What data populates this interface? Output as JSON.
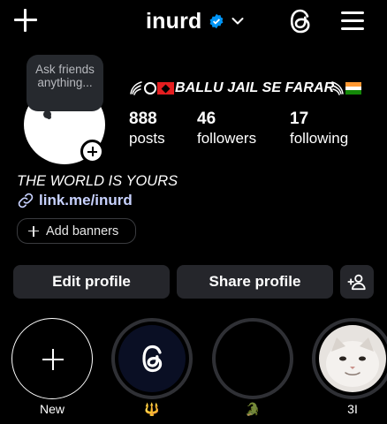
{
  "header": {
    "username": "inurd"
  },
  "note": {
    "text": "Ask friends anything..."
  },
  "profile": {
    "display_name": "BALLU JAIL SE FARAR",
    "stats": [
      {
        "value": "888",
        "label": "posts"
      },
      {
        "value": "46",
        "label": "followers"
      },
      {
        "value": "17",
        "label": "following"
      }
    ],
    "bio": "THE WORLD IS YOURS",
    "link": "link.me/inurd"
  },
  "buttons": {
    "add_banners": "Add banners",
    "edit_profile": "Edit profile",
    "share_profile": "Share profile"
  },
  "highlights": [
    {
      "label": "New",
      "icon": "plus-icon"
    },
    {
      "label": "🔱",
      "icon": "threads-logo-icon"
    },
    {
      "label": "🐊",
      "icon": "black-circle"
    },
    {
      "label": "3I",
      "icon": "cat-photo"
    }
  ],
  "colors": {
    "background": "#000000",
    "button_bg": "#25262b",
    "link": "#c8d2ff",
    "verified": "#0095f6",
    "note_bg": "#26292e"
  }
}
